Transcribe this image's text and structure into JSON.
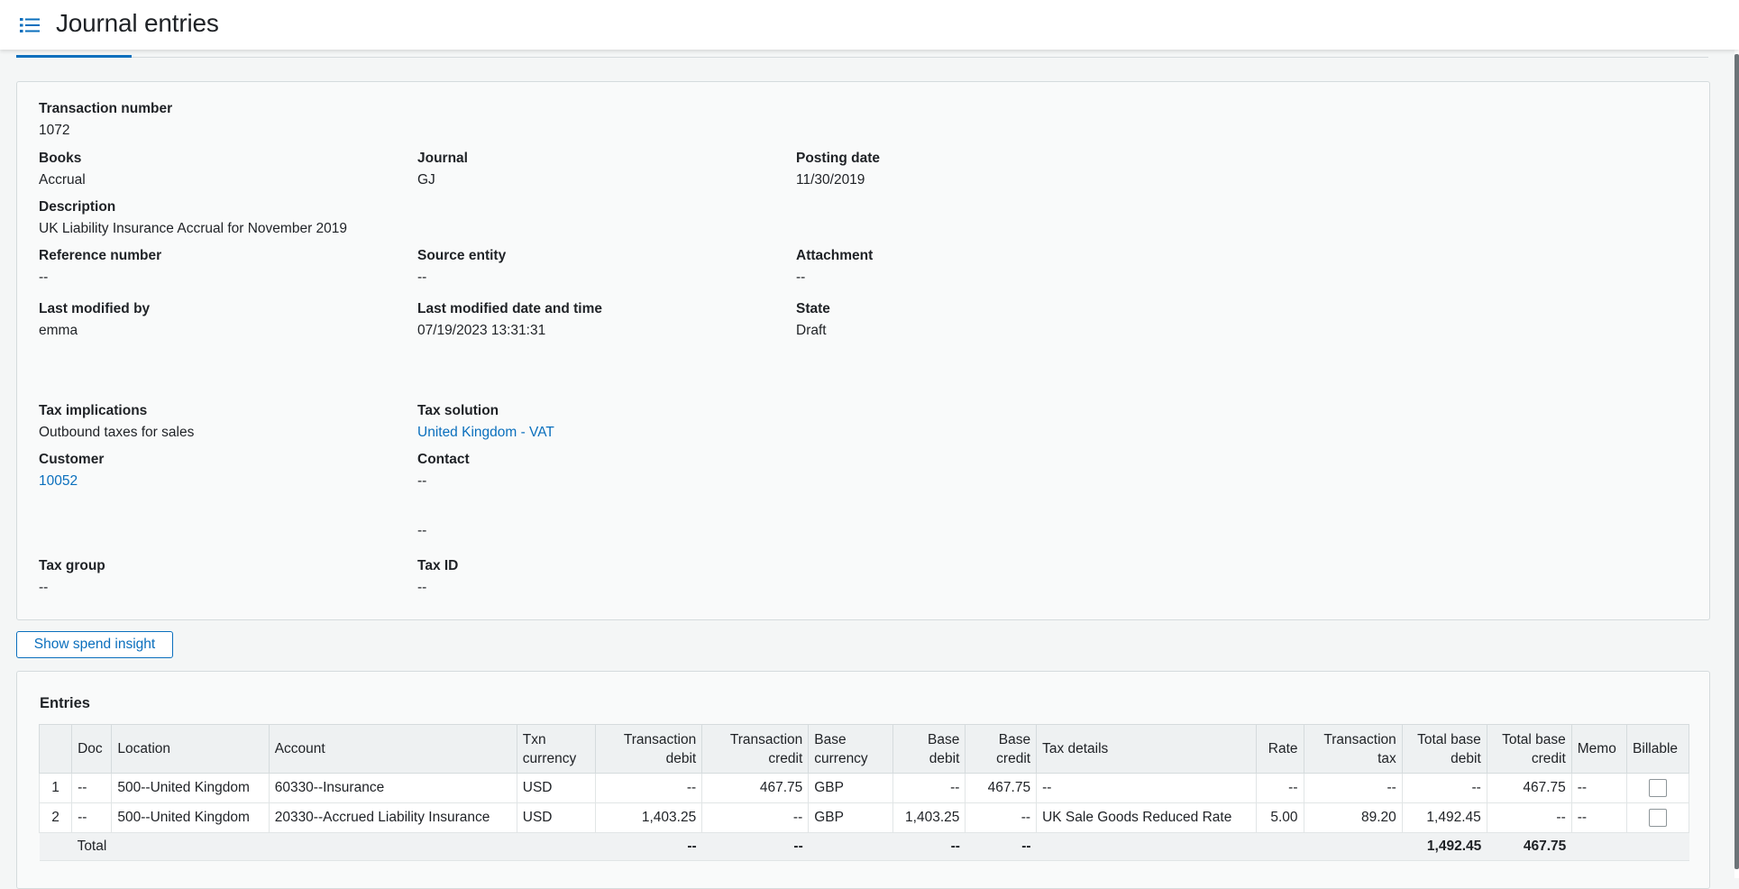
{
  "page": {
    "title": "Journal entries"
  },
  "header": {
    "transaction_number": {
      "label": "Transaction number",
      "value": "1072"
    },
    "books": {
      "label": "Books",
      "value": "Accrual"
    },
    "journal": {
      "label": "Journal",
      "value": "GJ"
    },
    "posting_date": {
      "label": "Posting date",
      "value": "11/30/2019"
    },
    "description": {
      "label": "Description",
      "value": "UK Liability Insurance Accrual for November 2019"
    },
    "reference_number": {
      "label": "Reference number",
      "value": "--"
    },
    "source_entity": {
      "label": "Source entity",
      "value": "--"
    },
    "attachment": {
      "label": "Attachment",
      "value": "--"
    },
    "last_modified_by": {
      "label": "Last modified by",
      "value": "emma"
    },
    "last_modified_date": {
      "label": "Last modified date and time",
      "value": "07/19/2023 13:31:31"
    },
    "state": {
      "label": "State",
      "value": "Draft"
    },
    "tax_implications": {
      "label": "Tax implications",
      "value": "Outbound taxes for sales"
    },
    "tax_solution": {
      "label": "Tax solution",
      "value": "United Kingdom - VAT"
    },
    "customer": {
      "label": "Customer",
      "value": "10052"
    },
    "contact": {
      "label": "Contact",
      "value": "--",
      "extra": "--"
    },
    "tax_group": {
      "label": "Tax group",
      "value": "--"
    },
    "tax_id": {
      "label": "Tax ID",
      "value": "--"
    }
  },
  "actions": {
    "show_spend_insight": "Show spend insight"
  },
  "entries": {
    "title": "Entries",
    "columns": [
      "",
      "Doc",
      "Location",
      "Account",
      "Txn currency",
      "Transaction debit",
      "Transaction credit",
      "Base currency",
      "Base debit",
      "Base credit",
      "Tax details",
      "Rate",
      "Transaction tax",
      "Total base debit",
      "Total base credit",
      "Memo",
      "Billable"
    ],
    "rows": [
      [
        "1",
        "--",
        "500--United Kingdom",
        "60330--Insurance",
        "USD",
        "--",
        "467.75",
        "GBP",
        "--",
        "467.75",
        "--",
        "--",
        "--",
        "--",
        "467.75",
        "--"
      ],
      [
        "2",
        "--",
        "500--United Kingdom",
        "20330--Accrued Liability Insurance",
        "USD",
        "1,403.25",
        "--",
        "GBP",
        "1,403.25",
        "--",
        "UK Sale Goods Reduced Rate",
        "5.00",
        "89.20",
        "1,492.45",
        "--",
        "--"
      ]
    ],
    "total": {
      "label": "Total",
      "transaction_debit": "--",
      "transaction_credit": "--",
      "base_debit": "--",
      "base_credit": "--",
      "total_base_debit": "1,492.45",
      "total_base_credit": "467.75"
    }
  },
  "colors": {
    "accent": "#0a6fbd",
    "border": "#d5dbdd",
    "background": "#f4f6f6"
  }
}
